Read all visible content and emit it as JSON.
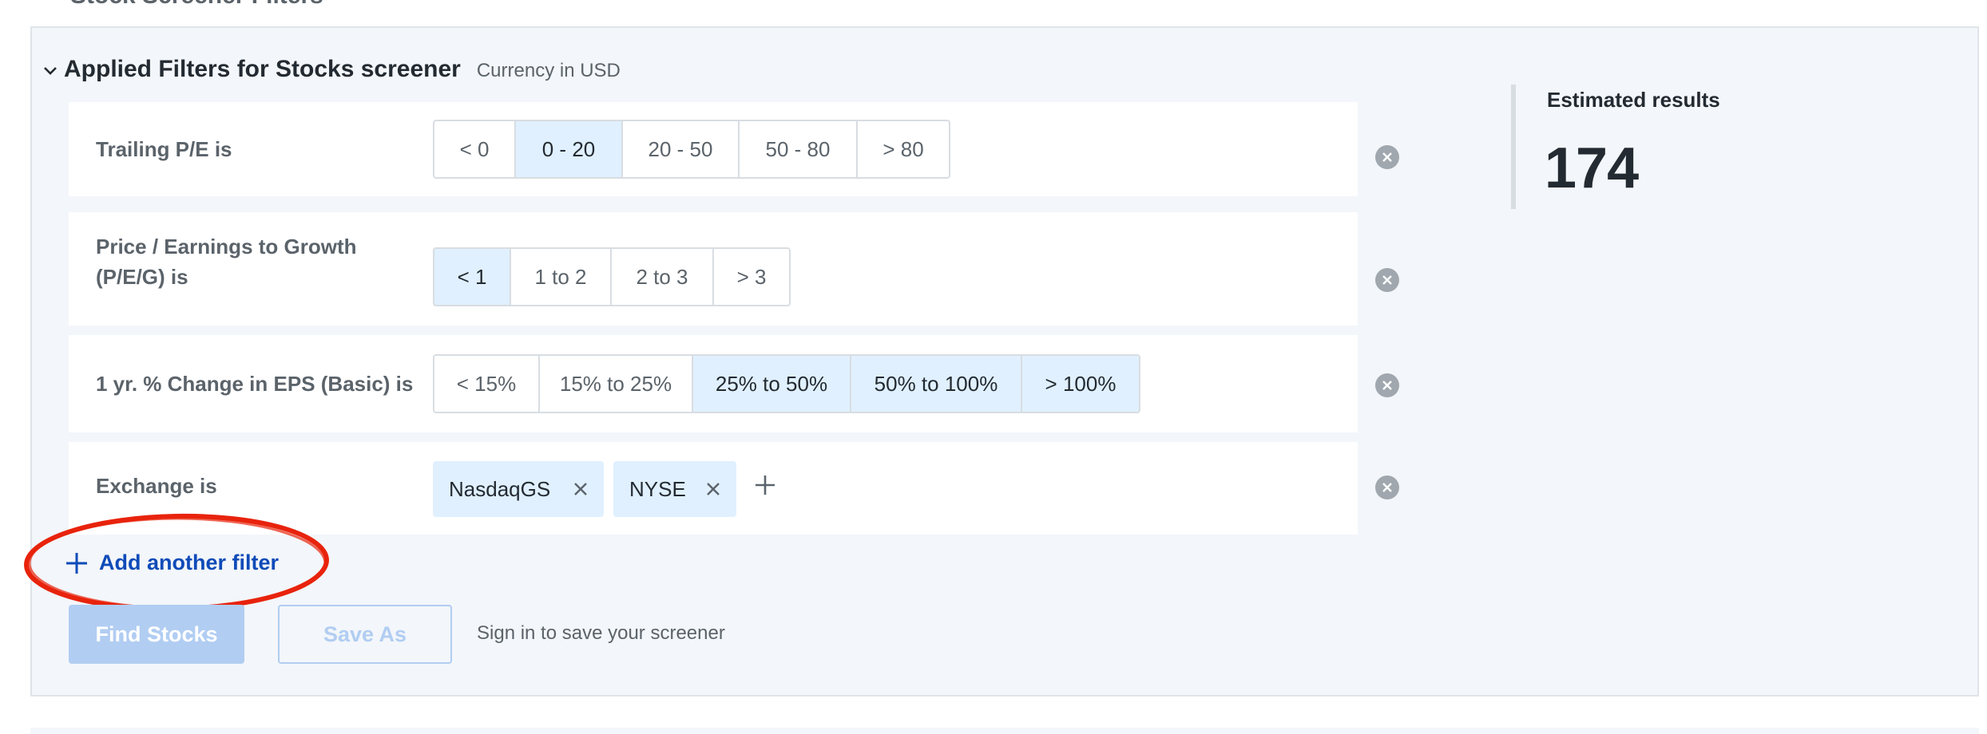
{
  "top_cut_text": "Stock Screener Filters",
  "header": {
    "title": "Applied Filters for Stocks screener",
    "currency": "Currency in USD"
  },
  "filters": [
    {
      "label": "Trailing P/E  is",
      "options": [
        {
          "label": "< 0",
          "selected": false
        },
        {
          "label": "0 - 20",
          "selected": true
        },
        {
          "label": "20 - 50",
          "selected": false
        },
        {
          "label": "50 - 80",
          "selected": false
        },
        {
          "label": "> 80",
          "selected": false
        }
      ]
    },
    {
      "label_line1": "Price / Earnings to Growth",
      "label_line2": "(P/E/G)  is",
      "options": [
        {
          "label": "< 1",
          "selected": true
        },
        {
          "label": "1 to 2",
          "selected": false
        },
        {
          "label": "2 to 3",
          "selected": false
        },
        {
          "label": "> 3",
          "selected": false
        }
      ]
    },
    {
      "label": "1 yr. % Change in EPS (Basic)  is",
      "options": [
        {
          "label": "< 15%",
          "selected": false
        },
        {
          "label": "15% to 25%",
          "selected": false
        },
        {
          "label": "25% to 50%",
          "selected": true
        },
        {
          "label": "50% to 100%",
          "selected": true
        },
        {
          "label": "> 100%",
          "selected": true
        }
      ]
    },
    {
      "label": "Exchange  is",
      "tags": [
        "NasdaqGS",
        "NYSE"
      ]
    }
  ],
  "add_filter_label": "Add another filter",
  "buttons": {
    "find": "Find Stocks",
    "save_as": "Save As"
  },
  "signin_text": "Sign in to save your screener",
  "results": {
    "label": "Estimated results",
    "value": "174"
  },
  "colors": {
    "accent": "#0f4bb8",
    "selected_bg": "#e0f0ff",
    "panel_bg": "#f3f6fa",
    "annotation": "#e8230c"
  },
  "icons": {
    "chevron": "chevron-down-icon",
    "remove": "close-circle-icon",
    "tag_remove": "close-icon",
    "add": "plus-icon"
  }
}
